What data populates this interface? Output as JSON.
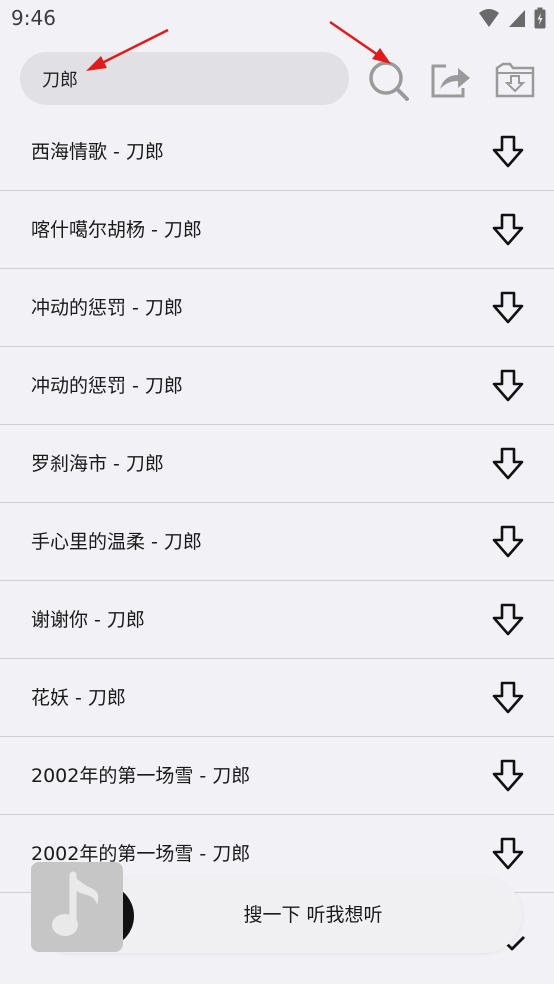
{
  "status_bar": {
    "time": "9:46",
    "icons": [
      "wifi-icon",
      "signal-icon",
      "battery-charging-icon"
    ]
  },
  "search": {
    "value": "刀郎",
    "placeholder": ""
  },
  "header_icons": [
    "search-icon",
    "share-icon",
    "download-folder-icon"
  ],
  "songs": [
    {
      "title": "西海情歌 - 刀郎"
    },
    {
      "title": "喀什噶尔胡杨 - 刀郎"
    },
    {
      "title": "冲动的惩罚 - 刀郎"
    },
    {
      "title": "冲动的惩罚 - 刀郎"
    },
    {
      "title": "罗刹海市 - 刀郎"
    },
    {
      "title": "手心里的温柔 - 刀郎"
    },
    {
      "title": "谢谢你 - 刀郎"
    },
    {
      "title": "花妖 - 刀郎"
    },
    {
      "title": "2002年的第一场雪 - 刀郎"
    },
    {
      "title": "2002年的第一场雪 - 刀郎"
    }
  ],
  "player": {
    "text": "搜一下 听我想听"
  },
  "colors": {
    "background": "#f2f1f6",
    "search_box": "#e1e0e5",
    "divider": "#cfced3",
    "annotation_arrow": "#e01b1b",
    "icon_gray": "#9a9a9a"
  }
}
